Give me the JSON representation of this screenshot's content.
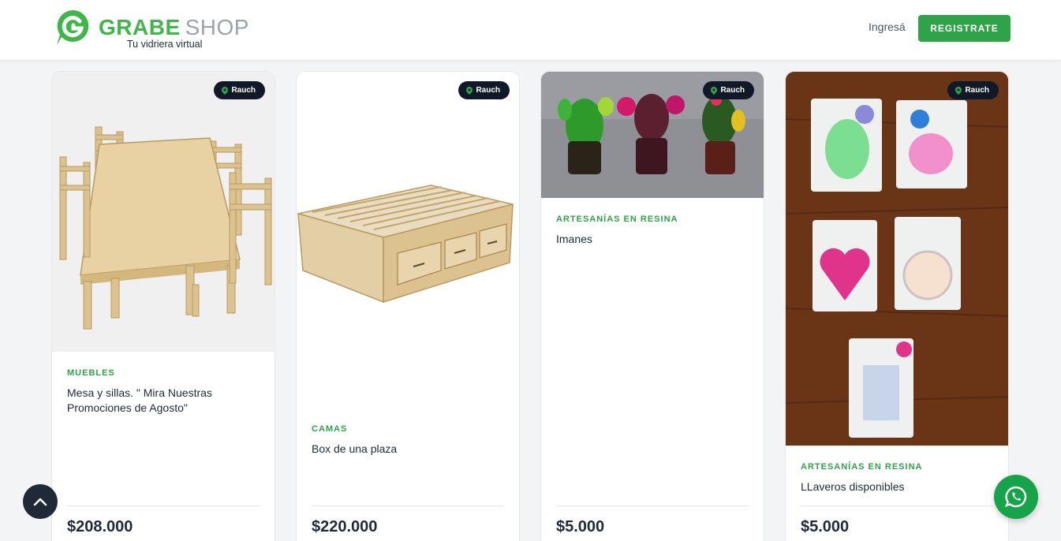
{
  "header": {
    "brand_main": "GRABE",
    "brand_secondary": "SHOP",
    "tagline": "Tu vidriera virtual",
    "login_label": "Ingresá",
    "register_label": "REGISTRATE"
  },
  "colors": {
    "accent": "#2fa34a",
    "badge_bg": "#111827",
    "whatsapp": "#16a34a"
  },
  "products": [
    {
      "location": "Rauch",
      "category": "MUEBLES",
      "title": "Mesa y sillas. \" Mira Nuestras Promociones de Agosto\"",
      "price": "$208.000",
      "image": "wooden-table-and-chairs"
    },
    {
      "location": "Rauch",
      "category": "CAMAS",
      "title": "Box de una plaza",
      "price": "$220.000",
      "image": "wooden-bed-box"
    },
    {
      "location": "Rauch",
      "category": "ARTESANÍAS EN RESINA",
      "title": "Imanes",
      "price": "$5.000",
      "image": "resin-cactus-magnets"
    },
    {
      "location": "Rauch",
      "category": "ARTESANÍAS EN RESINA",
      "title": "LLaveros disponibles",
      "price": "$5.000",
      "image": "resin-keychains"
    }
  ],
  "icons": {
    "scroll_top": "chevron-up-icon",
    "whatsapp": "whatsapp-icon",
    "location": "map-pin-icon"
  }
}
